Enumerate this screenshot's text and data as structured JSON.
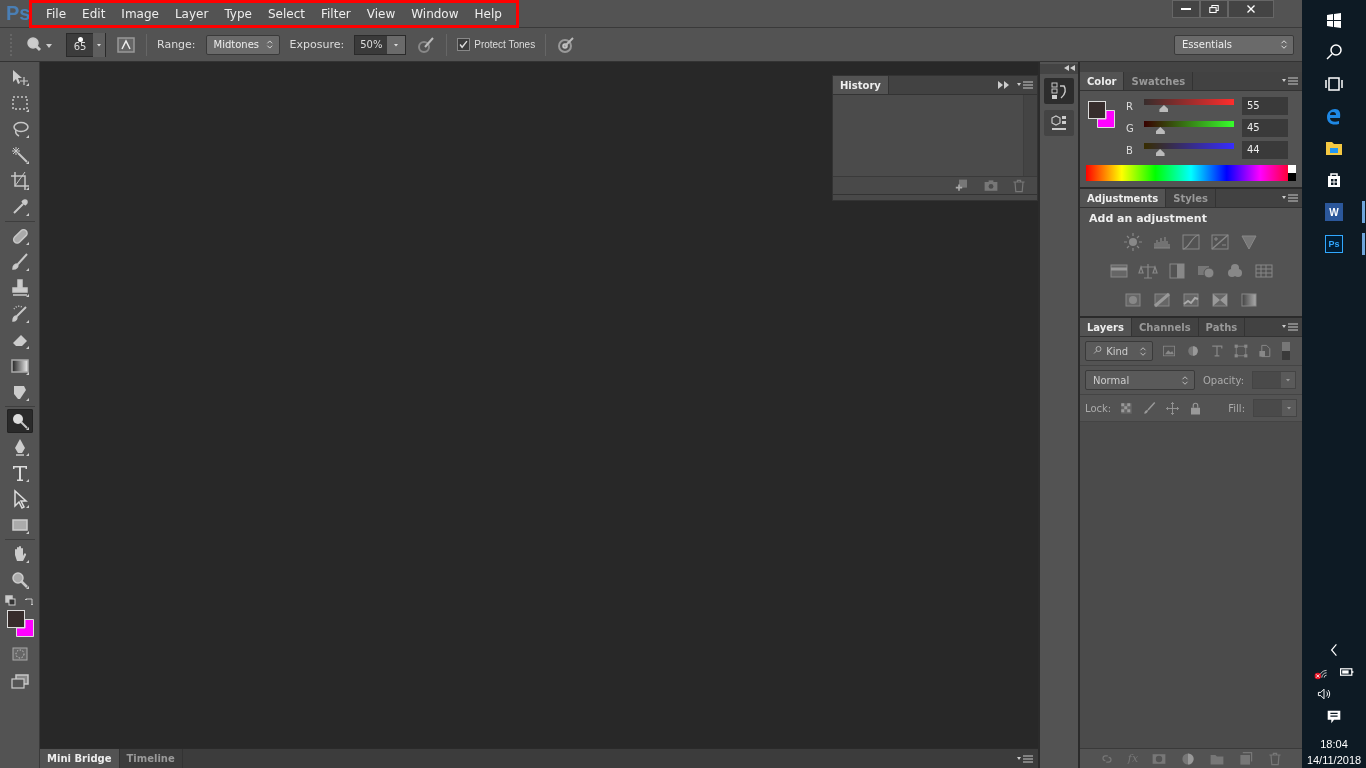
{
  "app_logo": "Ps",
  "menu_highlight": true,
  "menu": [
    "File",
    "Edit",
    "Image",
    "Layer",
    "Type",
    "Select",
    "Filter",
    "View",
    "Window",
    "Help"
  ],
  "options": {
    "brush_size": "65",
    "range_label": "Range:",
    "range_value": "Midtones",
    "exposure_label": "Exposure:",
    "exposure_value": "50%",
    "protect_tones": {
      "label": "Protect Tones",
      "checked": true
    },
    "workspace": "Essentials"
  },
  "tools": [
    {
      "kind": "move",
      "selected": false
    },
    {
      "kind": "marquee",
      "selected": false
    },
    {
      "kind": "lasso",
      "selected": false
    },
    {
      "kind": "wand",
      "selected": false
    },
    {
      "kind": "crop",
      "selected": false
    },
    {
      "kind": "eyedropper",
      "selected": false
    },
    {
      "kind": "heal",
      "selected": false
    },
    {
      "kind": "brush",
      "selected": false
    },
    {
      "kind": "stamp",
      "selected": false
    },
    {
      "kind": "history",
      "selected": false
    },
    {
      "kind": "eraser",
      "selected": false
    },
    {
      "kind": "gradient",
      "selected": false
    },
    {
      "kind": "blur",
      "selected": false
    },
    {
      "kind": "dodge",
      "selected": true
    },
    {
      "kind": "pen",
      "selected": false
    },
    {
      "kind": "type",
      "selected": false
    },
    {
      "kind": "path",
      "selected": false
    },
    {
      "kind": "rectangle",
      "selected": false
    },
    {
      "kind": "hand",
      "selected": false
    },
    {
      "kind": "zoom",
      "selected": false
    }
  ],
  "history_panel": {
    "tabs": [
      {
        "label": "History",
        "selected": true
      }
    ]
  },
  "bottom_tabs": [
    {
      "label": "Mini Bridge",
      "selected": true
    },
    {
      "label": "Timeline",
      "selected": false
    }
  ],
  "color_panel": {
    "tabs": [
      {
        "label": "Color",
        "selected": true
      },
      {
        "label": "Swatches",
        "selected": false
      }
    ],
    "channels": [
      {
        "name": "R",
        "level": 0.216,
        "value": "55"
      },
      {
        "name": "G",
        "level": 0.176,
        "value": "45"
      },
      {
        "name": "B",
        "level": 0.173,
        "value": "44"
      }
    ]
  },
  "adjustments_panel": {
    "tabs": [
      {
        "label": "Adjustments",
        "selected": true
      },
      {
        "label": "Styles",
        "selected": false
      }
    ],
    "heading": "Add an adjustment"
  },
  "layers_panel": {
    "tabs": [
      {
        "label": "Layers",
        "selected": true
      },
      {
        "label": "Channels",
        "selected": false
      },
      {
        "label": "Paths",
        "selected": false
      }
    ],
    "filter": "Kind",
    "blend_mode": "Normal",
    "opacity_label": "Opacity:",
    "lock_label": "Lock:",
    "fill_label": "Fill:",
    "fx": "fx"
  },
  "taskbar": {
    "apps": [
      {
        "kind": "start"
      },
      {
        "kind": "search"
      },
      {
        "kind": "taskview"
      },
      {
        "kind": "edge"
      },
      {
        "kind": "explorer"
      },
      {
        "kind": "store"
      },
      {
        "kind": "word",
        "running": true,
        "label": "W"
      },
      {
        "kind": "photoshop",
        "running": true,
        "label": "Ps"
      }
    ],
    "time": "18:04",
    "date": "14/11/2018"
  }
}
